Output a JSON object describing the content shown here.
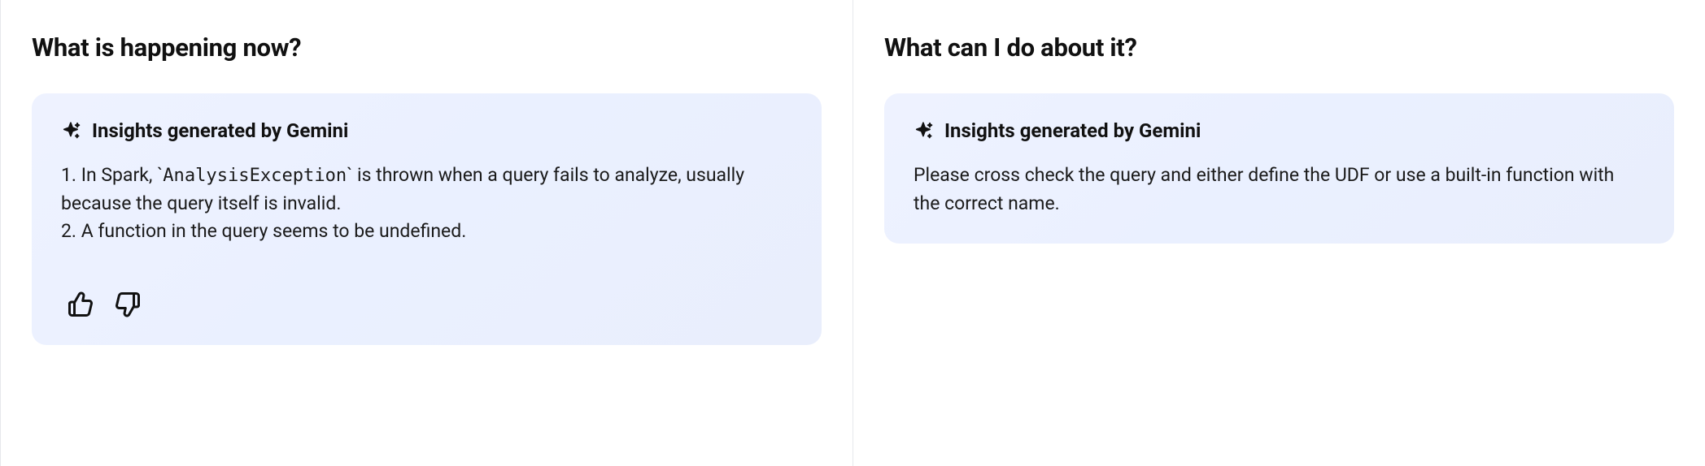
{
  "left": {
    "heading": "What is happening now?",
    "insight_title": "Insights generated by Gemini",
    "body_line1_pre": "1. In Spark, `",
    "body_line1_code": "AnalysisException",
    "body_line1_post": "` is thrown when a query fails to analyze, usually because the query itself is invalid.",
    "body_line2": "2. A function in the query seems to be undefined."
  },
  "right": {
    "heading": "What can I do about it?",
    "insight_title": "Insights generated by Gemini",
    "body": "Please cross check the query and either define the UDF or use a built-in function with the correct name."
  },
  "icons": {
    "sparkle": "sparkle-icon",
    "thumbs_up": "thumbs-up-icon",
    "thumbs_down": "thumbs-down-icon"
  }
}
